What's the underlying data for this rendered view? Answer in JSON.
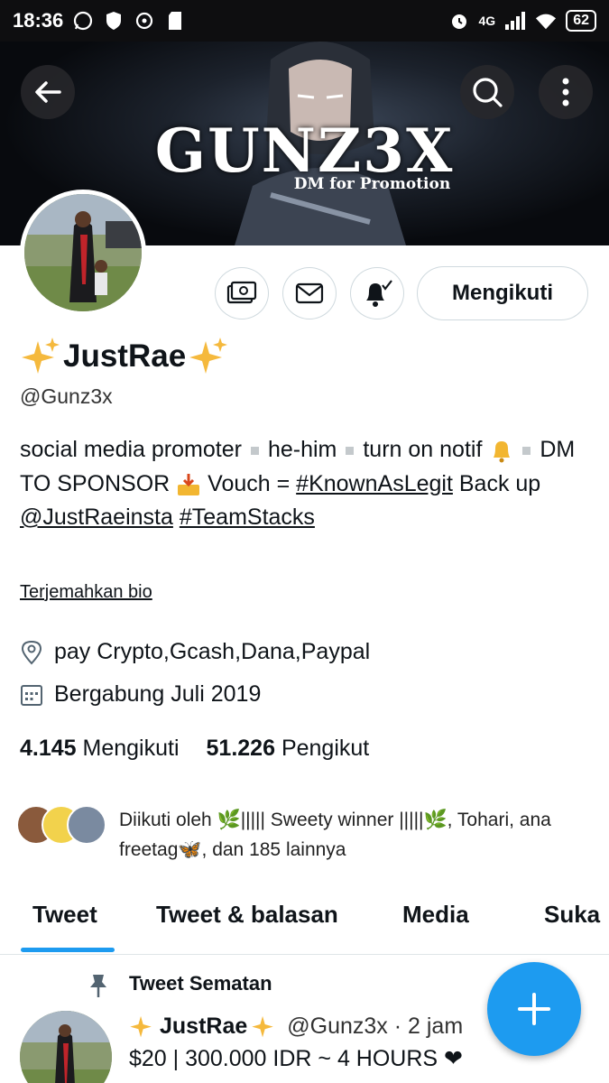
{
  "status_bar": {
    "time": "18:36",
    "network": "4G",
    "battery": "62"
  },
  "banner": {
    "title": "GUNZ3X",
    "subtitle": "DM for Promotion"
  },
  "profile": {
    "follow_button": "Mengikuti",
    "display_name": "JustRae",
    "handle": "@Gunz3x",
    "bio": {
      "part1": "social media promoter",
      "part2": "he-him",
      "part3": "turn on notif",
      "part4": "DM TO SPONSOR",
      "part5": "Vouch =",
      "hashtag1": "#KnownAsLegit",
      "part6": "Back up",
      "mention": "@JustRaeinsta",
      "hashtag2": "#TeamStacks"
    },
    "translate_bio": "Terjemahkan bio",
    "location": "pay Crypto,Gcash,Dana,Paypal",
    "joined": "Bergabung Juli 2019",
    "following_count": "4.145",
    "following_label": "Mengikuti",
    "followers_count": "51.226",
    "followers_label": "Pengikut",
    "followed_by": "Diikuti oleh 🌿||||| Sweety winner |||||🌿, Tohari, ana freetag🦋, dan 185 lainnya"
  },
  "tabs": [
    "Tweet",
    "Tweet & balasan",
    "Media",
    "Suka"
  ],
  "pinned": {
    "label": "Tweet Sematan",
    "name": "JustRae",
    "handle_time": "@Gunz3x · 2 jam",
    "text": "$20 | 300.000 IDR ~ 4 HOURS ❤"
  },
  "colors": {
    "accent": "#1d9bf0",
    "text": "#0f1419",
    "border": "#cfd9de"
  }
}
